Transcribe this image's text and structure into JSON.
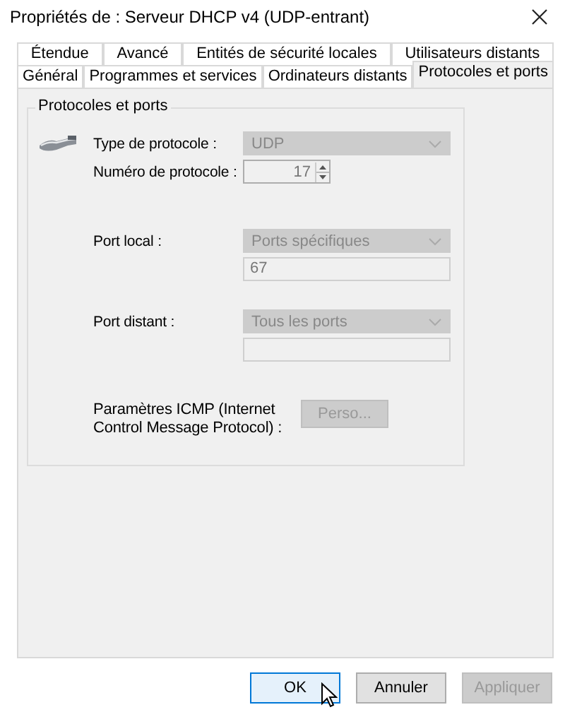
{
  "window": {
    "title": "Propriétés de : Serveur DHCP v4 (UDP-entrant)"
  },
  "tab_rows": [
    [
      {
        "label": "Étendue",
        "selected": false
      },
      {
        "label": "Avancé",
        "selected": false
      },
      {
        "label": "Entités de sécurité locales",
        "selected": false
      },
      {
        "label": "Utilisateurs distants",
        "selected": false
      }
    ],
    [
      {
        "label": "Général",
        "selected": false
      },
      {
        "label": "Programmes et services",
        "selected": false
      },
      {
        "label": "Ordinateurs distants",
        "selected": false
      },
      {
        "label": "Protocoles et ports",
        "selected": true
      }
    ]
  ],
  "group": {
    "title": "Protocoles et ports",
    "protocol_type": {
      "label": "Type de protocole :",
      "value": "UDP",
      "disabled": true
    },
    "protocol_number": {
      "label": "Numéro de protocole :",
      "value": "17"
    },
    "local_port": {
      "label": "Port local :",
      "value": "Ports spécifiques",
      "disabled": true,
      "ports": "67"
    },
    "remote_port": {
      "label": "Port distant :",
      "value": "Tous les ports",
      "disabled": true
    },
    "icmp": {
      "label": "Paramètres ICMP (Internet Control Message Protocol) :",
      "button": "Perso...",
      "disabled": true
    }
  },
  "buttons": [
    {
      "label": "OK",
      "default": true,
      "disabled": false
    },
    {
      "label": "Annuler",
      "default": false,
      "disabled": false
    },
    {
      "label": "Appliquer",
      "default": false,
      "disabled": true
    }
  ]
}
